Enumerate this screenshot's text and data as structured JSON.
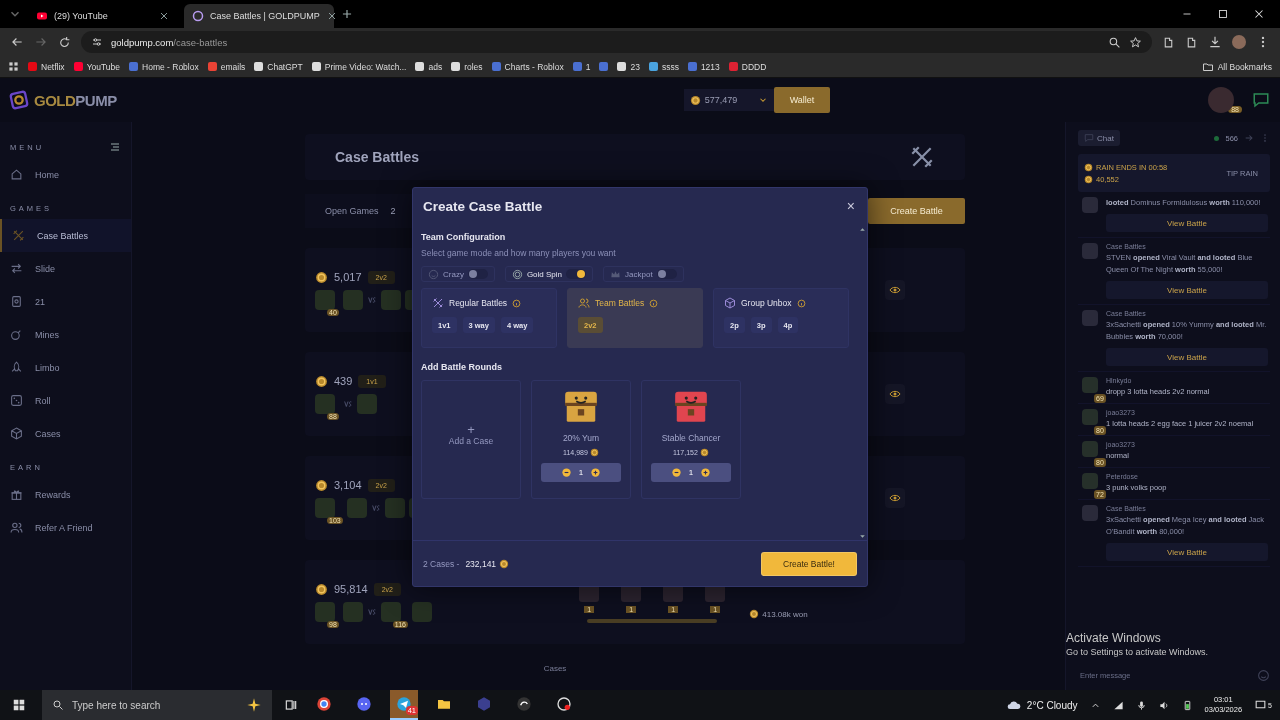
{
  "browser": {
    "tabs": [
      {
        "title": "(29) YouTube",
        "selected": false
      },
      {
        "title": "Case Battles | GOLDPUMP",
        "selected": true
      }
    ],
    "url_host": "goldpump.com",
    "url_path": "/case-battles",
    "bookmarks": [
      {
        "kind": "labelled",
        "label": "Netflix"
      },
      {
        "kind": "labelled",
        "label": "YouTube"
      },
      {
        "kind": "labelled",
        "label": "Home - Roblox"
      },
      {
        "kind": "labelled",
        "label": "emails"
      },
      {
        "kind": "labelled",
        "label": "ChatGPT"
      },
      {
        "kind": "labelled",
        "label": "Prime Video: Watch..."
      },
      {
        "kind": "labelled",
        "label": "ads"
      },
      {
        "kind": "labelled",
        "label": "roles"
      },
      {
        "kind": "labelled",
        "label": "Charts - Roblox"
      },
      {
        "kind": "labelled",
        "label": "1"
      },
      {
        "kind": "icon"
      },
      {
        "kind": "labelled",
        "label": "23"
      },
      {
        "kind": "labelled",
        "label": "ssss"
      },
      {
        "kind": "labelled",
        "label": "1213"
      },
      {
        "kind": "labelled",
        "label": "DDDD"
      }
    ],
    "all_bookmarks": "All Bookmarks"
  },
  "site": {
    "logo_gold": "GOLD",
    "logo_rest": "PUMP",
    "balance": "577,479",
    "wallet": "Wallet",
    "avatar_badge": "88"
  },
  "sidebar": {
    "sections": [
      {
        "heading": "MENU",
        "items": [
          {
            "label": "Home",
            "selected": false
          }
        ]
      },
      {
        "heading": "GAMES",
        "items": [
          {
            "label": "Case Battles",
            "selected": true
          },
          {
            "label": "Slide",
            "selected": false
          },
          {
            "label": "21",
            "selected": false
          },
          {
            "label": "Mines",
            "selected": false
          },
          {
            "label": "Limbo",
            "selected": false
          },
          {
            "label": "Roll",
            "selected": false
          },
          {
            "label": "Cases",
            "selected": false
          }
        ]
      },
      {
        "heading": "EARN",
        "items": [
          {
            "label": "Rewards",
            "selected": false
          },
          {
            "label": "Refer A Friend",
            "selected": false
          }
        ]
      }
    ]
  },
  "main": {
    "title": "Case Battles",
    "open_games": "Open Games",
    "open_count": "2",
    "create_button": "Create Battle",
    "battles": [
      {
        "amount": "5,017",
        "mode": "2v2",
        "left": [
          {
            "kind": "badged",
            "badge": "40"
          },
          {
            "kind": "plain"
          }
        ],
        "right": [
          {
            "kind": "plain"
          },
          {
            "kind": "plain"
          }
        ]
      },
      {
        "amount": "439",
        "mode": "1v1",
        "left": [
          {
            "kind": "badged",
            "badge": "88"
          }
        ],
        "right": [
          {
            "kind": "plain"
          }
        ]
      },
      {
        "amount": "3,104",
        "mode": "2v2",
        "left": [
          {
            "kind": "badged",
            "badge": "103"
          },
          {
            "kind": "plain"
          }
        ],
        "right": [
          {
            "kind": "plain"
          },
          {
            "kind": "plain"
          }
        ]
      },
      {
        "amount": "95,814",
        "mode": "2v2",
        "left": [
          {
            "kind": "badged",
            "badge": "98"
          },
          {
            "kind": "plain"
          }
        ],
        "right": [
          {
            "kind": "badged",
            "badge": "116"
          },
          {
            "kind": "plain"
          }
        ],
        "cases": [
          {
            "count": "1"
          },
          {
            "count": "1"
          },
          {
            "count": "1"
          },
          {
            "count": "1"
          }
        ],
        "won": "413.08k won"
      }
    ],
    "footer_label": "Cases"
  },
  "modal": {
    "title": "Create Case Battle",
    "close": "×",
    "config_title": "Team Configuration",
    "config_hint": "Select game mode and how many players you want",
    "toggles": [
      {
        "label": "Crazy",
        "on": false
      },
      {
        "label": "Gold Spin",
        "on": true
      },
      {
        "label": "Jackpot",
        "on": false
      }
    ],
    "modes": [
      {
        "label": "Regular Battles",
        "selected": false,
        "options": [
          "1v1",
          "3 way",
          "4 way"
        ]
      },
      {
        "label": "Team Battles",
        "selected": true,
        "options": [
          "2v2"
        ]
      },
      {
        "label": "Group Unbox",
        "selected": false,
        "options": [
          "2p",
          "3p",
          "4p"
        ]
      }
    ],
    "rounds_title": "Add Battle Rounds",
    "add_plus": "+",
    "add_label": "Add a Case",
    "cases": [
      {
        "name": "20% Yum",
        "price": "114,989",
        "qty": "1",
        "color": "#d9a441"
      },
      {
        "name": "Stable Chancer",
        "price": "117,152",
        "qty": "1",
        "color": "#e0454f"
      }
    ],
    "summary_count": "2 Cases -",
    "summary_total": "232,141",
    "submit": "Create Battle!"
  },
  "chat": {
    "tab": "Chat",
    "online": "566",
    "rain_label": "RAIN ENDS IN 00:58",
    "rain_amount": "40,552",
    "tip_rain": "TIP RAIN",
    "messages": [
      {
        "kind": "battle",
        "text": "**looted** Dominus Formidulosus **worth** 110,000!",
        "button": "View Battle"
      },
      {
        "kind": "battle",
        "author": "Case Battles",
        "text": "STVEN **opened** Viral Vault **and looted** Blue Queen Of The Night **worth** 55,000!",
        "button": "View Battle"
      },
      {
        "kind": "battle",
        "author": "Case Battles",
        "text": "3xSachetti **opened** 10% Yummy **and looted** Mr. Bubbles **worth** 70,000!",
        "button": "View Battle"
      },
      {
        "kind": "user",
        "author": "Hlnkydo",
        "badge": "69",
        "text": "dropp 3 lotta heads 2v2 normal"
      },
      {
        "kind": "user",
        "author": "joao3273",
        "badge": "80",
        "text": "1 lotta heads 2 egg face 1 juicer 2v2 noemal"
      },
      {
        "kind": "user",
        "author": "joao3273",
        "badge": "80",
        "text": "normal"
      },
      {
        "kind": "user",
        "author": "Peterdose",
        "badge": "72",
        "text": "3 punk volks poop"
      },
      {
        "kind": "battle",
        "author": "Case Battles",
        "text": "3xSachetti **opened** Mega Icey **and looted** Jack O'Bandit **worth** 80,000!",
        "button": "View Battle"
      }
    ],
    "input_placeholder": "Enter message"
  },
  "os": {
    "activate_title": "Activate Windows",
    "activate_hint": "Go to Settings to activate Windows.",
    "search": "Type here to search",
    "telegram_badge": "41",
    "weather": "2°C Cloudy",
    "time": "03:01",
    "date": "03/03/2026",
    "notifications": "5"
  }
}
